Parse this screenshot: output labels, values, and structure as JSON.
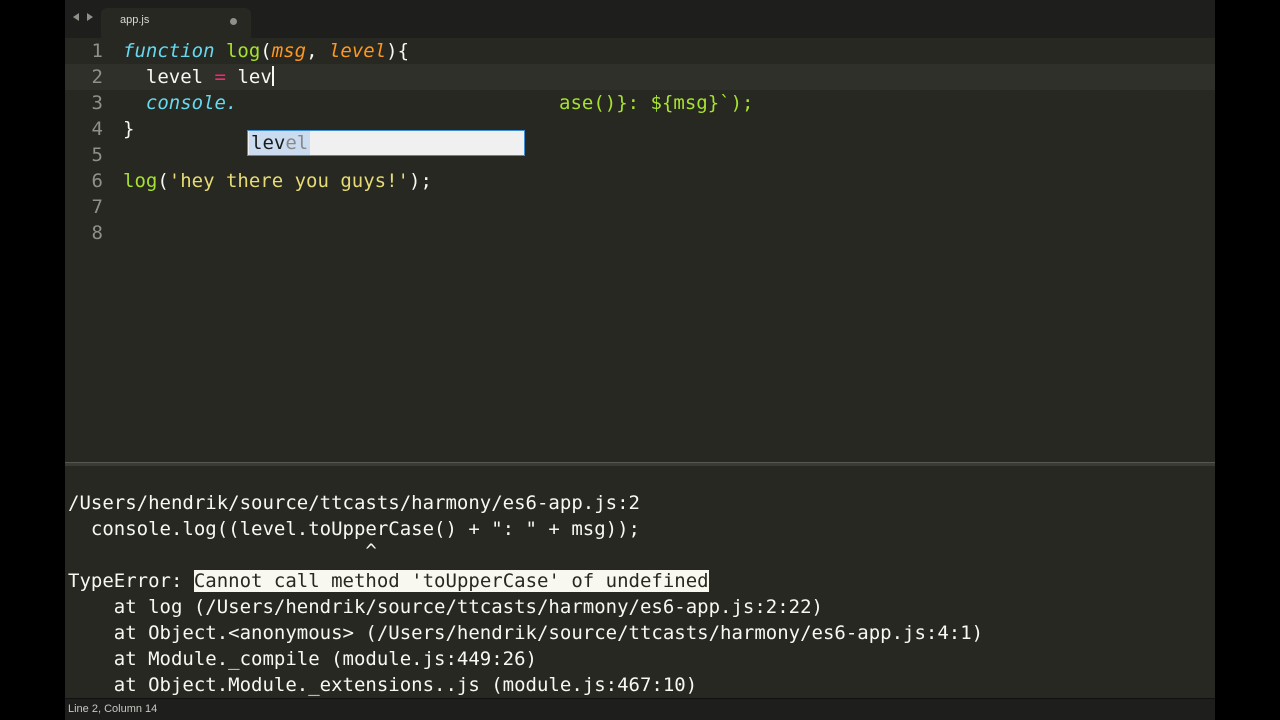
{
  "tab": {
    "filename": "app.js"
  },
  "editor": {
    "line_numbers": [
      "1",
      "2",
      "3",
      "4",
      "5",
      "6",
      "7",
      "8"
    ],
    "line1": {
      "kw": "function",
      "name": "log",
      "p1": "msg",
      "sep": ", ",
      "p2": "level",
      "end": "){"
    },
    "line2": {
      "lhs": "level",
      "op": "=",
      "typed": "lev"
    },
    "line3": {
      "prefix": "console.",
      "tail": "ase()}: ${msg}`);"
    },
    "line4": {
      "text": "}"
    },
    "line6": {
      "call": "log",
      "open": "(",
      "str": "'hey there you guys!'",
      "close": ");"
    }
  },
  "autocomplete": {
    "match": "lev",
    "rest": "el"
  },
  "console": {
    "lines": [
      "/Users/hendrik/source/ttcasts/harmony/es6-app.js:2",
      "  console.log((level.toUpperCase() + \": \" + msg));",
      "                          ^",
      "    at log (/Users/hendrik/source/ttcasts/harmony/es6-app.js:2:22)",
      "    at Object.<anonymous> (/Users/hendrik/source/ttcasts/harmony/es6-app.js:4:1)",
      "    at Module._compile (module.js:449:26)",
      "    at Object.Module._extensions..js (module.js:467:10)"
    ],
    "error_label": "TypeError: ",
    "error_message": "Cannot call method 'toUpperCase' of undefined"
  },
  "status": {
    "text": "Line 2, Column 14"
  },
  "colors": {
    "background": "#272822",
    "keyword": "#66d9ef",
    "function": "#a6e22e",
    "parameter": "#fd971f",
    "string": "#e6db74",
    "operator": "#f92672"
  }
}
